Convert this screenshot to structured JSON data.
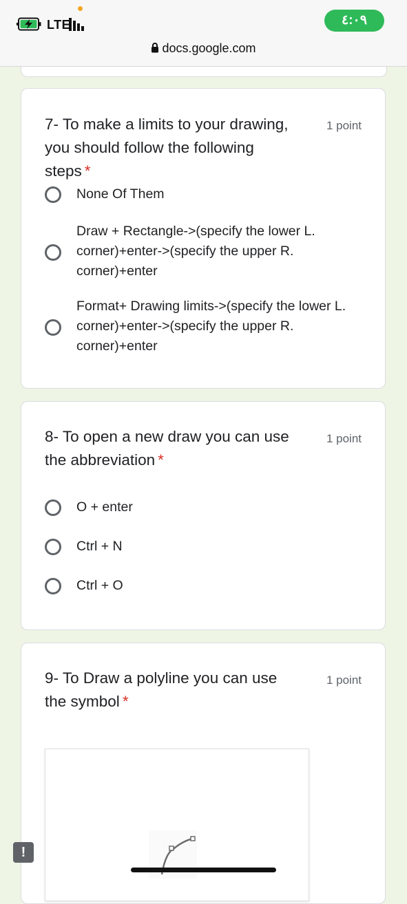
{
  "status_bar": {
    "network": "LTE",
    "time": "٤:٠٩",
    "url": "docs.google.com",
    "time_pill_color": "#2fba5a"
  },
  "questions": [
    {
      "title": "7- To make a limits to your drawing, you should follow the following steps",
      "points": "1 point",
      "required": "*",
      "options": [
        "None Of Them",
        "Draw + Rectangle->(specify the lower L. corner)+enter->(specify the upper R. corner)+enter",
        "Format+ Drawing limits->(specify the lower L. corner)+enter->(specify the upper R. corner)+enter"
      ]
    },
    {
      "title": "8- To open a new draw you can use the abbreviation",
      "points": "1 point",
      "required": "*",
      "options": [
        "O + enter",
        "Ctrl + N",
        "Ctrl + O"
      ]
    },
    {
      "title": "9- To Draw a polyline you can use the symbol",
      "points": "1 point",
      "required": "*",
      "image_icon": "polyline-symbol-icon"
    }
  ],
  "feedback_icon": "report-issue-icon",
  "colors": {
    "required": "#d93025",
    "page_background": "#eef5e5",
    "radio_border": "#5f6368"
  }
}
